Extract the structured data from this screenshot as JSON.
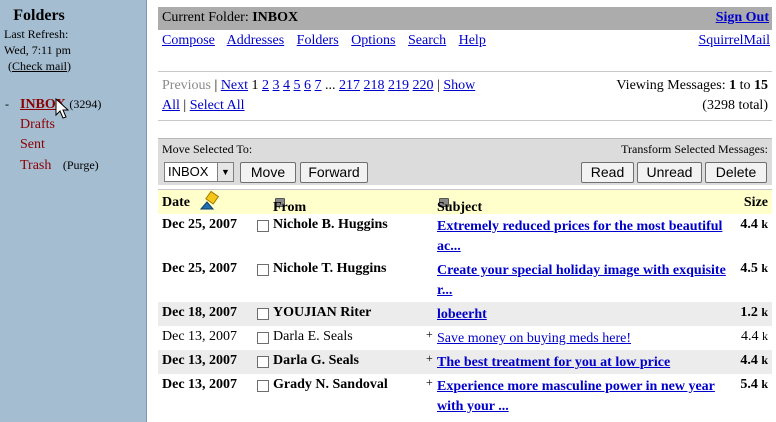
{
  "sidebar": {
    "title": "Folders",
    "last_refresh_label": "Last Refresh:",
    "last_refresh_time": "Wed, 7:11 pm",
    "check_mail": "Check mail",
    "check_mail_open": "(",
    "check_mail_close": ")",
    "folders": [
      {
        "name": "INBOX",
        "count": "(3294)",
        "dash": "-"
      },
      {
        "name": "Drafts"
      },
      {
        "name": "Sent"
      },
      {
        "name": "Trash",
        "extra": "(Purge)"
      }
    ]
  },
  "header": {
    "current_folder_label": "Current Folder:",
    "current_folder": "INBOX",
    "sign_out": "Sign Out"
  },
  "menu": {
    "items": [
      "Compose",
      "Addresses",
      "Folders",
      "Options",
      "Search",
      "Help"
    ],
    "brand": "SquirrelMail"
  },
  "pager": {
    "previous": "Previous",
    "sep1": "|",
    "next": "Next",
    "pages": [
      "1",
      "2",
      "3",
      "4",
      "5",
      "6",
      "7"
    ],
    "ellipsis": "...",
    "far_pages": [
      "217",
      "218",
      "219",
      "220"
    ],
    "sep2": "|",
    "show": "Show",
    "all": "All",
    "sep3": "|",
    "select_all": "Select All",
    "viewing_label": "Viewing Messages:",
    "view_from": "1",
    "view_to_label": "to",
    "view_to": "15",
    "total": "(3298 total)"
  },
  "actions": {
    "move_label": "Move Selected To:",
    "transform_label": "Transform Selected Messages:",
    "move_target": "INBOX",
    "move_btn": "Move",
    "forward_btn": "Forward",
    "read_btn": "Read",
    "unread_btn": "Unread",
    "delete_btn": "Delete"
  },
  "table": {
    "headers": {
      "date": "Date",
      "from": "From",
      "subject": "Subject",
      "size": "Size"
    },
    "rows": [
      {
        "date": "Dec 25, 2007",
        "from": "Nichole B. Huggins",
        "subject": "Extremely reduced prices for the most beautiful ac...",
        "size": "4.4",
        "unit": "k",
        "unread": true,
        "shade": false,
        "plus": false
      },
      {
        "date": "Dec 25, 2007",
        "from": "Nichole T. Huggins",
        "subject": "Create your special holiday image with exquisite r...",
        "size": "4.5",
        "unit": "k",
        "unread": true,
        "shade": false,
        "plus": false
      },
      {
        "date": "Dec 18, 2007",
        "from": "YOUJIAN Riter",
        "subject": "lobeerht",
        "size": "1.2",
        "unit": "k",
        "unread": true,
        "shade": true,
        "plus": false
      },
      {
        "date": "Dec 13, 2007",
        "from": "Darla E. Seals",
        "subject": "Save money on buying meds here!",
        "size": "4.4",
        "unit": "k",
        "unread": false,
        "shade": false,
        "plus": true
      },
      {
        "date": "Dec 13, 2007",
        "from": "Darla G. Seals",
        "subject": "The best treatment for you at low price",
        "size": "4.4",
        "unit": "k",
        "unread": true,
        "shade": true,
        "plus": true
      },
      {
        "date": "Dec 13, 2007",
        "from": "Grady N. Sandoval",
        "subject": "Experience more masculine power in new year with your ...",
        "size": "5.4",
        "unit": "k",
        "unread": true,
        "shade": false,
        "plus": true
      }
    ]
  }
}
